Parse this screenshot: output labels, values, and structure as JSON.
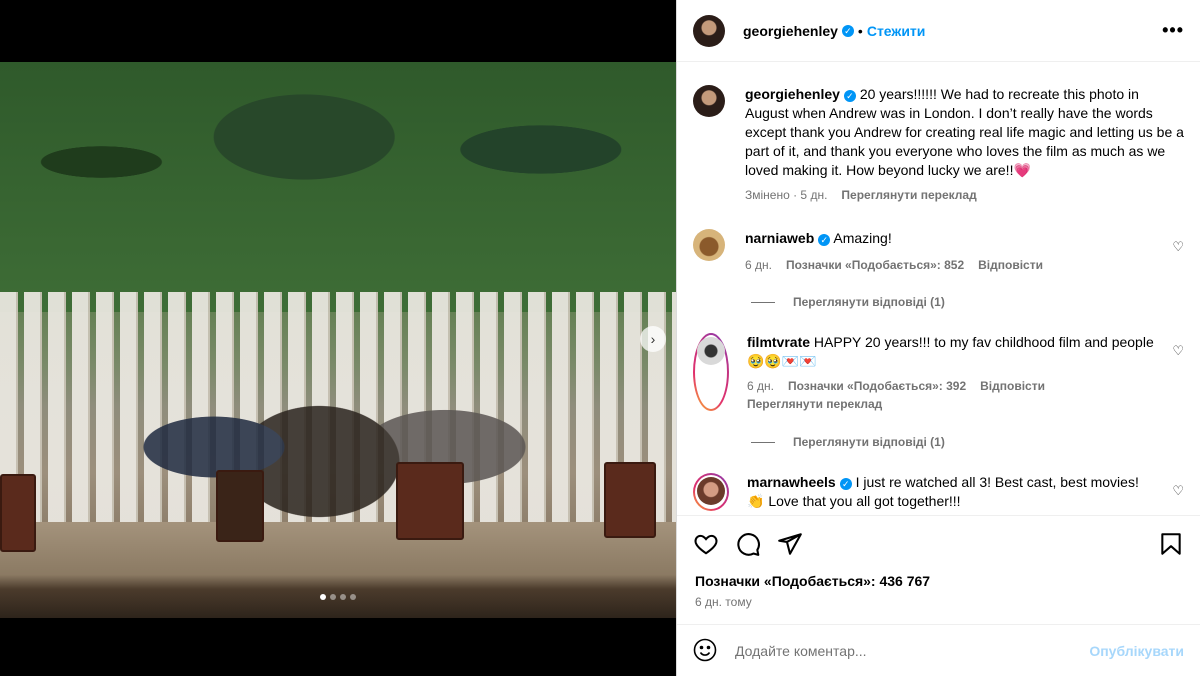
{
  "post": {
    "author": "georgiehenley",
    "follow_label": "Стежити",
    "separator": "•",
    "more_label": "•••",
    "carousel_next": "›",
    "carousel_dots": 4,
    "carousel_active_index": 0
  },
  "caption": {
    "username": "georgiehenley",
    "text": "20 years!!!!!! We had to recreate this photo in August when Andrew was in London. I don’t really have the words except thank you Andrew for creating real life magic and letting us be a part of it, and thank you everyone who loves the film as much as we loved making it. How beyond lucky we are!!💗",
    "edited": "Змінено · 5 дн.",
    "see_translation": "Переглянути переклад"
  },
  "comments": [
    {
      "username": "narniaweb",
      "verified": true,
      "text": "Amazing!",
      "time": "6 дн.",
      "likes": "Позначки «Подобається»: 852",
      "reply": "Відповісти",
      "view_replies": "Переглянути відповіді (1)"
    },
    {
      "username": "filmtvrate",
      "verified": false,
      "text": "HAPPY 20 years!!! to my fav childhood film and people 🥹🥹💌💌",
      "time": "6 дн.",
      "likes": "Позначки «Подобається»: 392",
      "reply": "Відповісти",
      "see_translation": "Переглянути переклад",
      "view_replies": "Переглянути відповіді (1)"
    },
    {
      "username": "marnawheels",
      "verified": true,
      "text": "I just re watched all 3! Best cast, best movies! 👏 Love that you all got together!!!"
    }
  ],
  "footer": {
    "likes": "Позначки «Подобається»: 436 767",
    "date": "6 дн. тому",
    "comment_placeholder": "Додайте коментар...",
    "publish_label": "Опублікувати"
  },
  "icons": {
    "like": "heart-icon",
    "comment": "comment-icon",
    "share": "share-icon",
    "save": "bookmark-icon",
    "emoji": "emoji-icon"
  },
  "colors": {
    "link_blue": "#0095f6",
    "publish_disabled": "#a7d7fb",
    "muted": "#737373"
  }
}
